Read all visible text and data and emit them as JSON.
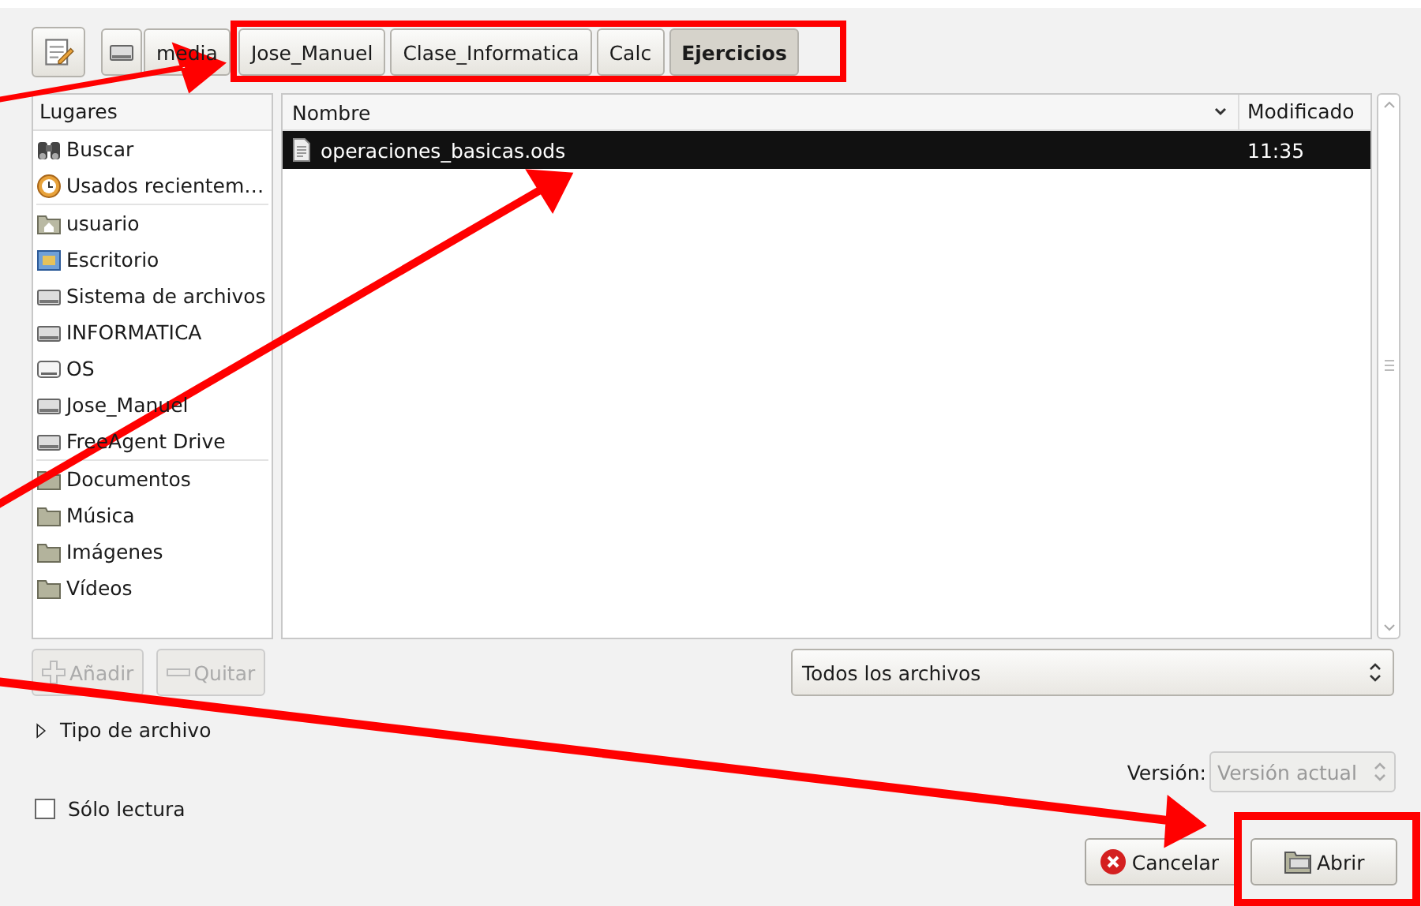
{
  "path_bar": {
    "edit_toggle": {
      "selected": false
    },
    "buttons": [
      {
        "label": "media",
        "kind": "drive",
        "selected": false
      },
      {
        "label": "Jose_Manuel",
        "kind": "folder",
        "selected": false
      },
      {
        "label": "Clase_Informatica",
        "kind": "folder",
        "selected": false
      },
      {
        "label": "Calc",
        "kind": "folder",
        "selected": false
      },
      {
        "label": "Ejercicios",
        "kind": "folder",
        "selected": true
      }
    ]
  },
  "sidebar": {
    "header": "Lugares",
    "groups": [
      [
        {
          "label": "Buscar",
          "kind": "search"
        },
        {
          "label": "Usados recientem…",
          "kind": "recent"
        }
      ],
      [
        {
          "label": "usuario",
          "kind": "home"
        },
        {
          "label": "Escritorio",
          "kind": "desktop"
        },
        {
          "label": "Sistema de archivos",
          "kind": "drive"
        },
        {
          "label": "INFORMATICA",
          "kind": "drive"
        },
        {
          "label": "OS",
          "kind": "disk"
        },
        {
          "label": "Jose_Manuel",
          "kind": "drive"
        },
        {
          "label": "FreeAgent Drive",
          "kind": "drive"
        }
      ],
      [
        {
          "label": "Documentos",
          "kind": "folder"
        },
        {
          "label": "Música",
          "kind": "folder"
        },
        {
          "label": "Imágenes",
          "kind": "folder"
        },
        {
          "label": "Vídeos",
          "kind": "folder"
        }
      ]
    ],
    "add_button": {
      "label": "Añadir",
      "disabled": true
    },
    "remove_button": {
      "label": "Quitar",
      "disabled": true
    }
  },
  "file_list": {
    "columns": [
      "Nombre",
      "Modificado"
    ],
    "rows": [
      {
        "name": "operaciones_basicas.ods",
        "modified": "11:35",
        "selected": true
      }
    ]
  },
  "filter": {
    "value": "Todos los archivos"
  },
  "expander": {
    "label": "Tipo de archivo",
    "expanded": false
  },
  "version": {
    "label": "Versión:",
    "value": "Versión actual",
    "disabled": true
  },
  "read_only": {
    "label": "Sólo lectura",
    "checked": false
  },
  "buttons": [
    {
      "label": "Cancelar",
      "kind": "cancel"
    },
    {
      "label": "Abrir",
      "kind": "open"
    }
  ]
}
